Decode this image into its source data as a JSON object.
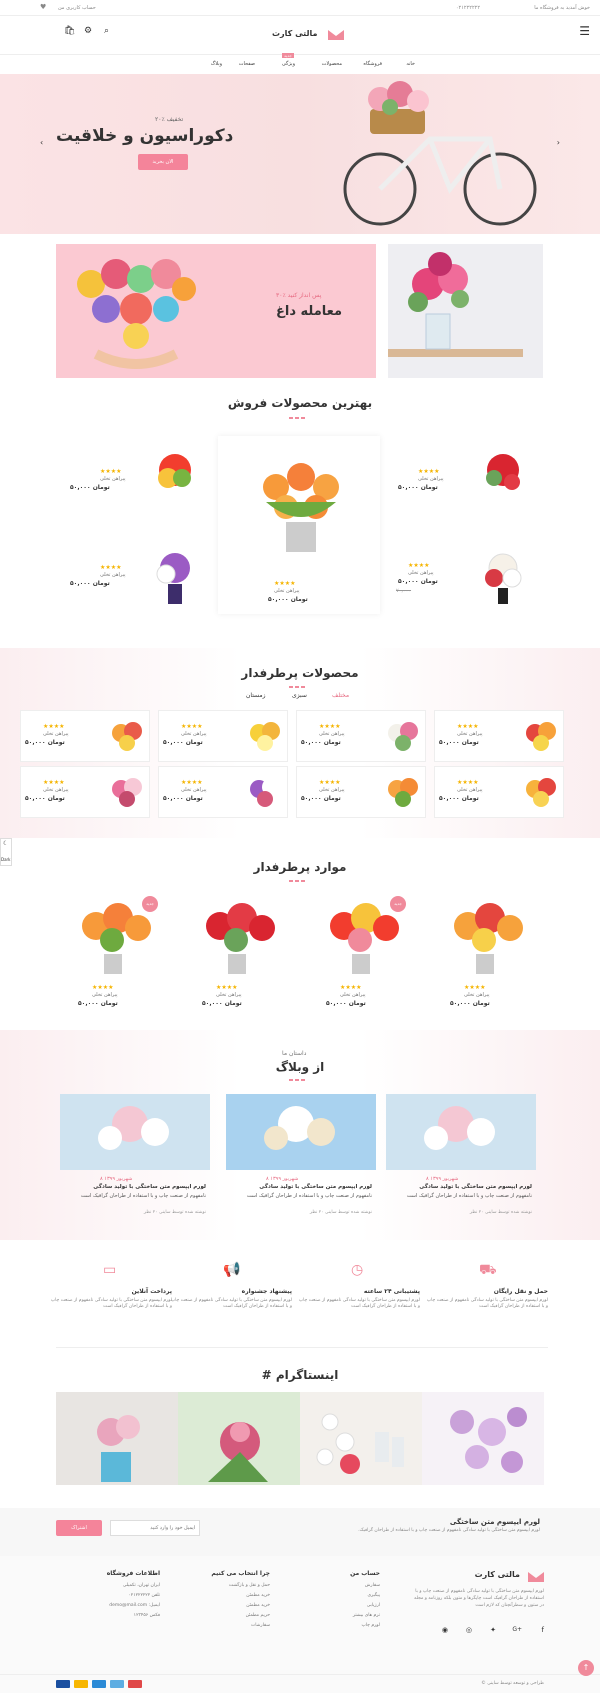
{
  "topbar": {
    "welcome": "خوش آمدید به فروشگاه ما",
    "phone": "۰۲۱۲۲۲۲۲۲",
    "account": "حساب کاربری من"
  },
  "header": {
    "logo": "مالتی کارت"
  },
  "nav": {
    "items": [
      "خانه",
      "فروشگاه",
      "محصولات",
      "ویژگی",
      "صفحات",
      "وبلاگ"
    ],
    "badge": "جدید"
  },
  "hero": {
    "discount": "۲۰٪ تخفیف",
    "title": "دکوراسیون و خلاقیت",
    "button": "الان بخرید"
  },
  "banner": {
    "tagline": "۳۰٪ پس انداز کنید",
    "title": "معامله داغ"
  },
  "best": {
    "title": "بهترین محصولات فروش",
    "name": "پیراهن تخلی",
    "price": "۵۰,۰۰۰ تومان",
    "old": "۷۰,۰۰۰"
  },
  "popular": {
    "title": "محصولات پرطرفدار",
    "tabs": [
      "مختلف",
      "سبزی",
      "زمستان"
    ]
  },
  "featured": {
    "title": "موارد پرطرفدار",
    "new_badge": "جدید"
  },
  "blog": {
    "subtitle": "داستان ما",
    "title": "از وبلاگ",
    "date": "۸ شهریور ۱۳۹۹",
    "post_title": "لورم ایپسوم متن ساختگی با تولید سادگی",
    "excerpt": "نامفهوم از صنعت چاپ و با استفاده از طراحان گرافیک است",
    "author": "نوشته شده توسط ساینی ۲۰ نظر"
  },
  "features": [
    {
      "title": "حمل و نقل رایگان",
      "text": "لورم ایپسوم متن ساختگی با تولید سادگی نامفهوم از صنعت چاپ و با استفاده از طراحان گرافیک است"
    },
    {
      "title": "پشتیبانی ۲۴ ساعته",
      "text": "لورم ایپسوم متن ساختگی با تولید سادگی نامفهوم از صنعت چاپ و با استفاده از طراحان گرافیک است"
    },
    {
      "title": "پیشنهاد جشنواره",
      "text": "لورم ایپسوم متن ساختگی با تولید سادگی نامفهوم از صنعت چاپ و با استفاده از طراحان گرافیک است"
    },
    {
      "title": "پرداخت آنلاین",
      "text": "لورم ایپسوم متن ساختگی با تولید سادگی نامفهوم از صنعت چاپ و با استفاده از طراحان گرافیک است"
    }
  ],
  "instagram": {
    "title": "# اینستاگرام"
  },
  "newsletter": {
    "title": "لورم ایپسوم متن ساختگی",
    "text": "لورم ایپسوم متن ساختگی با تولید سادگی نامفهوم از صنعت چاپ و با استفاده از طراحان گرافیک.",
    "placeholder": "ایمیل خود را وارد کنید",
    "button": "اشتراک"
  },
  "footer": {
    "about": "لورم ایپسوم متن ساختگی با تولید سادگی نامفهوم از صنعت چاپ و با استفاده از طراحان گرافیک است چاپگرها و متون بلکه روزنامه و مجله در ستون و سطرآنچنان که لازم است",
    "col1_title": "حساب من",
    "col1": [
      "سفارش",
      "پیگیری",
      "ارزیابی",
      "ترم های بیشتر",
      "لورم چاپ"
    ],
    "col2_title": "چرا انتخاب می کنیم",
    "col2": [
      "حمل و نقل و بازگشت",
      "خرید مطمئن",
      "خرید مطمئن",
      "حریم مطمئن",
      "سفارشات"
    ],
    "col3_title": "اطلاعات فروشگاه",
    "col3": [
      "ایران تهران، تکمیلی",
      "تلفن ۰۲۱۲۲۲۲۲۲",
      "ایمیل: demo@mail.com",
      "فکس ۱۲۳۴۵۶"
    ],
    "copyright": "© طراحی و توسعه توسط ساینی"
  },
  "side": {
    "dark": "Dark"
  }
}
